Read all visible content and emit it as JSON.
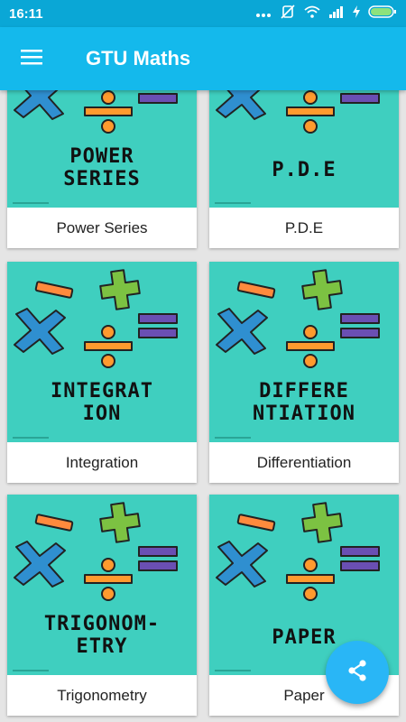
{
  "status_bar": {
    "time": "16:11",
    "icons": [
      "dots-icon",
      "mute-icon",
      "wifi-icon",
      "signal-icon",
      "charging-icon",
      "battery-icon"
    ]
  },
  "app_bar": {
    "title": "GTU Maths",
    "menu_icon": "hamburger-menu-icon"
  },
  "colors": {
    "status_bar": "#0aa7d6",
    "app_bar": "#14b9ec",
    "card_image_bg": "#3fcfbf",
    "fab": "#29b6f6"
  },
  "cards": [
    {
      "label": "Power Series",
      "image_text_lines": [
        "POWER",
        "SERIES"
      ]
    },
    {
      "label": "P.D.E",
      "image_text_lines": [
        "P.D.E"
      ]
    },
    {
      "label": "Integration",
      "image_text_lines": [
        "INTEGRAT",
        "ION"
      ]
    },
    {
      "label": "Differentiation",
      "image_text_lines": [
        "DIFFERE",
        "NTIATION"
      ]
    },
    {
      "label": "Trigonometry",
      "image_text_lines": [
        "TRIGONOM-",
        "ETRY"
      ]
    },
    {
      "label": "Paper",
      "image_text_lines": [
        "PAPER"
      ]
    }
  ],
  "fab": {
    "icon": "share-icon"
  }
}
